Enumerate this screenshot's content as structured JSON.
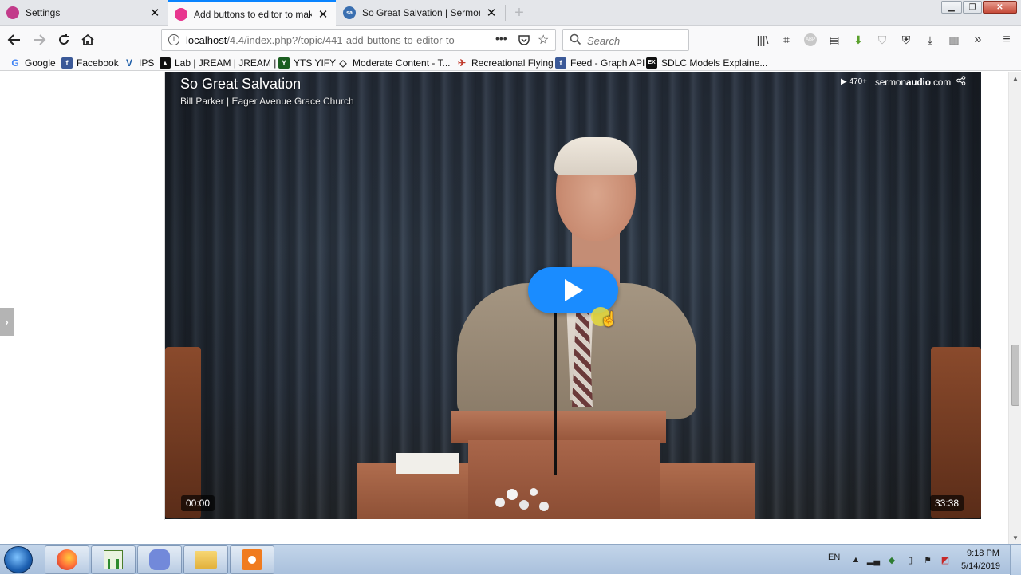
{
  "browser": {
    "tabs": [
      {
        "title": "Settings",
        "icon": "settings-favicon",
        "selected": false
      },
      {
        "title": "Add buttons to editor to make",
        "icon": "forum-favicon",
        "selected": true
      },
      {
        "title": "So Great Salvation | SermonAud",
        "icon": "sermonaudio-favicon",
        "selected": false
      }
    ],
    "new_tab_label": "+",
    "close_glyph": "✕",
    "url_host": "localhost",
    "url_path": "/4.4/index.php?/topic/441-add-buttons-to-editor-to",
    "search_placeholder": "Search",
    "bookmarks": [
      {
        "label": "Google",
        "icon": "google-icon"
      },
      {
        "label": "Facebook",
        "icon": "facebook-icon"
      },
      {
        "label": "IPS",
        "icon": "ips-icon"
      },
      {
        "label": "Lab | JREAM | JREAM | ...",
        "icon": "jream-icon"
      },
      {
        "label": "YTS YIFY",
        "icon": "yts-icon"
      },
      {
        "label": "Moderate Content - T...",
        "icon": "moderate-icon"
      },
      {
        "label": "Recreational Flying",
        "icon": "flying-icon"
      },
      {
        "label": "Feed - Graph API",
        "icon": "facebook-icon"
      },
      {
        "label": "SDLC Models Explaine...",
        "icon": "sdlc-icon"
      }
    ]
  },
  "video": {
    "title": "So Great Salvation",
    "subtitle": "Bill Parker | Eager Avenue Grace Church",
    "views": "▶ 470+",
    "brand_prefix": "sermon",
    "brand_bold": "audio",
    "brand_suffix": ".com",
    "current_time": "00:00",
    "duration": "33:38",
    "play_icon": "play-icon",
    "accent_color": "#1a8cff"
  },
  "taskbar": {
    "language": "EN",
    "time": "9:18 PM",
    "date": "5/14/2019",
    "apps": [
      "firefox-icon",
      "task-manager-icon",
      "discord-icon",
      "file-explorer-icon",
      "screenrecorder-icon"
    ]
  }
}
